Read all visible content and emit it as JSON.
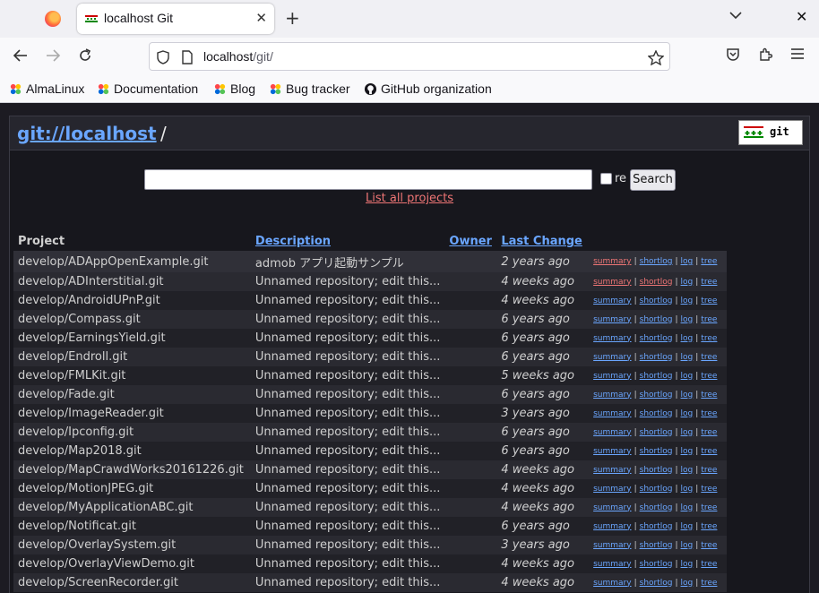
{
  "browser": {
    "tab_title": "localhost Git",
    "url_host": "localhost",
    "url_path": "/git/",
    "bookmarks": [
      "AlmaLinux",
      "Documentation",
      "Blog",
      "Bug tracker",
      "GitHub organization"
    ]
  },
  "header": {
    "home_link": "git://localhost",
    "separator": "/",
    "logo_text": "git"
  },
  "search": {
    "re_label": "re",
    "button_label": "Search",
    "list_all_label": "List all projects"
  },
  "table": {
    "headers": {
      "project": "Project",
      "description": "Description",
      "owner": "Owner",
      "last_change": "Last Change"
    },
    "link_labels": [
      "summary",
      "shortlog",
      "log",
      "tree"
    ],
    "link_separator": "|",
    "rows": [
      {
        "project": "develop/ADAppOpenExample.git",
        "description": "admob アプリ起動サンプル",
        "owner": "",
        "age": "2 years ago"
      },
      {
        "project": "develop/ADInterstitial.git",
        "description": "Unnamed repository; edit this...",
        "owner": "",
        "age": "4 weeks ago"
      },
      {
        "project": "develop/AndroidUPnP.git",
        "description": "Unnamed repository; edit this...",
        "owner": "",
        "age": "4 weeks ago"
      },
      {
        "project": "develop/Compass.git",
        "description": "Unnamed repository; edit this...",
        "owner": "",
        "age": "6 years ago"
      },
      {
        "project": "develop/EarningsYield.git",
        "description": "Unnamed repository; edit this...",
        "owner": "",
        "age": "6 years ago"
      },
      {
        "project": "develop/Endroll.git",
        "description": "Unnamed repository; edit this...",
        "owner": "",
        "age": "6 years ago"
      },
      {
        "project": "develop/FMLKit.git",
        "description": "Unnamed repository; edit this...",
        "owner": "",
        "age": "5 weeks ago"
      },
      {
        "project": "develop/Fade.git",
        "description": "Unnamed repository; edit this...",
        "owner": "",
        "age": "6 years ago"
      },
      {
        "project": "develop/ImageReader.git",
        "description": "Unnamed repository; edit this...",
        "owner": "",
        "age": "3 years ago"
      },
      {
        "project": "develop/Ipconfig.git",
        "description": "Unnamed repository; edit this...",
        "owner": "",
        "age": "6 years ago"
      },
      {
        "project": "develop/Map2018.git",
        "description": "Unnamed repository; edit this...",
        "owner": "",
        "age": "6 years ago"
      },
      {
        "project": "develop/MapCrawdWorks20161226.git",
        "description": "Unnamed repository; edit this...",
        "owner": "",
        "age": "4 weeks ago"
      },
      {
        "project": "develop/MotionJPEG.git",
        "description": "Unnamed repository; edit this...",
        "owner": "",
        "age": "4 weeks ago"
      },
      {
        "project": "develop/MyApplicationABC.git",
        "description": "Unnamed repository; edit this...",
        "owner": "",
        "age": "4 weeks ago"
      },
      {
        "project": "develop/Notificat.git",
        "description": "Unnamed repository; edit this...",
        "owner": "",
        "age": "6 years ago"
      },
      {
        "project": "develop/OverlaySystem.git",
        "description": "Unnamed repository; edit this...",
        "owner": "",
        "age": "3 years ago"
      },
      {
        "project": "develop/OverlayViewDemo.git",
        "description": "Unnamed repository; edit this...",
        "owner": "",
        "age": "4 weeks ago"
      },
      {
        "project": "develop/ScreenRecorder.git",
        "description": "Unnamed repository; edit this...",
        "owner": "",
        "age": "4 weeks ago"
      }
    ]
  }
}
